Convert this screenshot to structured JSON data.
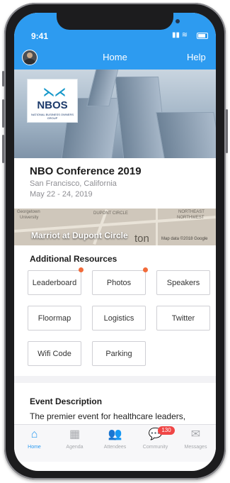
{
  "status_bar": {
    "time": "9:41",
    "signal_icons": "▮▮ ≋"
  },
  "header": {
    "title": "Home",
    "help_label": "Help"
  },
  "logo": {
    "mark": "⋋⋌",
    "text": "NBOS",
    "subtitle": "NATIONAL BUSINESS OWNERS GROUP"
  },
  "event": {
    "title": "NBO Conference 2019",
    "location": "San Francisco, California",
    "dates": "May 22 - 24, 2019"
  },
  "map": {
    "venue": "Marriot at Dupont Circle",
    "labels": [
      "Georgetown",
      "University",
      "DUPONT CIRCLE",
      "NORTHEAST",
      "NORTHWEST"
    ],
    "big_label": "ton",
    "credit": "Map data ©2018 Google"
  },
  "resources": {
    "title": "Additional Resources",
    "items": [
      {
        "label": "Leaderboard",
        "dot": true
      },
      {
        "label": "Photos",
        "dot": true
      },
      {
        "label": "Speakers",
        "dot": false
      },
      {
        "label": "Floormap",
        "dot": false
      },
      {
        "label": "Logistics",
        "dot": false
      },
      {
        "label": "Twitter",
        "dot": false
      },
      {
        "label": "Wifi Code",
        "dot": false
      },
      {
        "label": "Parking",
        "dot": false
      }
    ]
  },
  "description": {
    "title": "Event Description",
    "text": "The premier event for healthcare leaders,"
  },
  "tabs": [
    {
      "label": "Home",
      "icon": "house-icon",
      "glyph": "⌂"
    },
    {
      "label": "Agenda",
      "icon": "calendar-icon",
      "glyph": "▦"
    },
    {
      "label": "Attendees",
      "icon": "people-icon",
      "glyph": "👥"
    },
    {
      "label": "Community",
      "icon": "chat-icon",
      "glyph": "💬"
    },
    {
      "label": "Messages",
      "icon": "mail-icon",
      "glyph": "✉"
    }
  ],
  "community_badge": "130",
  "colors": {
    "accent": "#2d9bf0",
    "dot": "#f26b3a",
    "badge": "#f04646"
  }
}
